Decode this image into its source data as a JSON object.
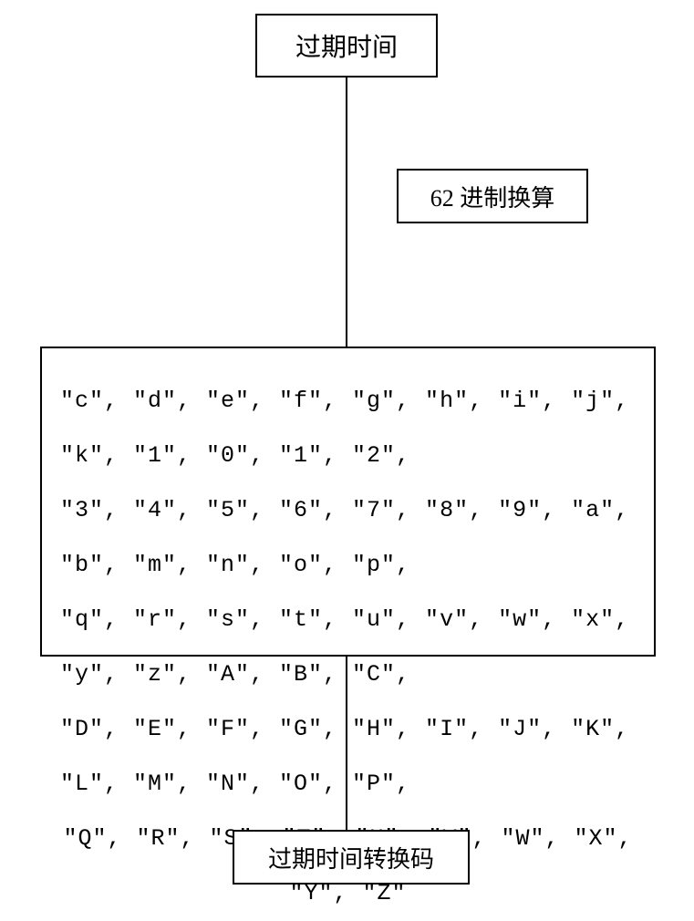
{
  "top_label": "过期时间",
  "convert_label": "62 进制换算",
  "char_line1": "\"c\", \"d\", \"e\", \"f\", \"g\", \"h\", \"i\", \"j\", \"k\", \"1\", \"0\", \"1\", \"2\",",
  "char_line2": "\"3\", \"4\", \"5\", \"6\", \"7\", \"8\", \"9\", \"a\", \"b\", \"m\", \"n\", \"o\", \"p\",",
  "char_line3": "\"q\", \"r\", \"s\", \"t\", \"u\", \"v\", \"w\", \"x\", \"y\", \"z\", \"A\", \"B\", \"C\",",
  "char_line4": "\"D\", \"E\", \"F\", \"G\", \"H\", \"I\", \"J\", \"K\", \"L\", \"M\", \"N\", \"O\", \"P\",",
  "char_line5": "\"Q\", \"R\", \"S\", \"T\", \"U\", \"V\", \"W\", \"X\", \"Y\", \"Z\"",
  "bottom_label": "过期时间转换码"
}
